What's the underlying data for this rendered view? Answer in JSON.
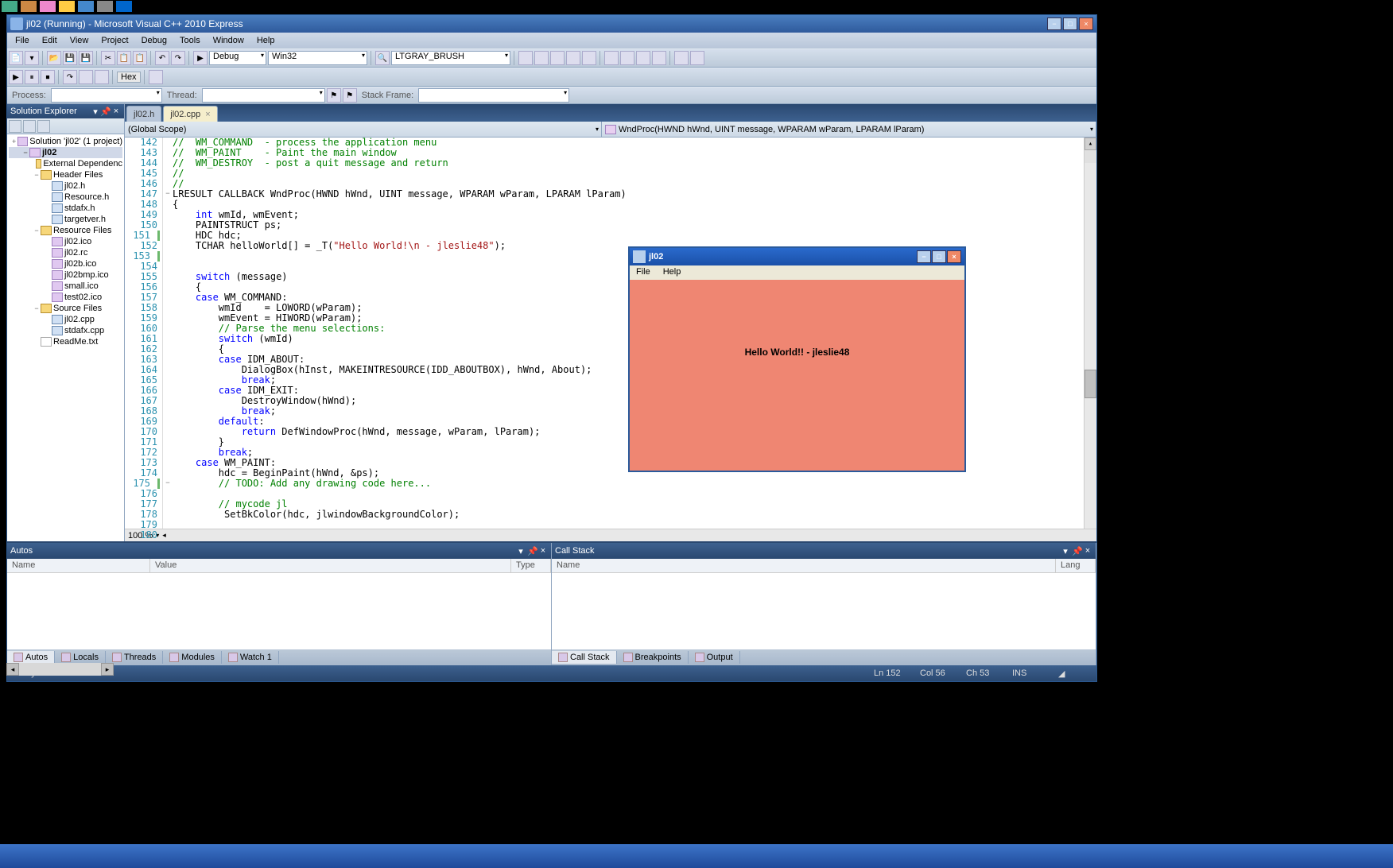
{
  "title": "jl02 (Running) - Microsoft Visual C++ 2010 Express",
  "menus": [
    "File",
    "Edit",
    "View",
    "Project",
    "Debug",
    "Tools",
    "Window",
    "Help"
  ],
  "config": "Debug",
  "platform": "Win32",
  "find": "LTGRAY_BRUSH",
  "hex": "Hex",
  "threadLabel": "Thread:",
  "stackLabel": "Stack Frame:",
  "solutionExplorer": {
    "title": "Solution Explorer"
  },
  "tree": [
    {
      "l": 0,
      "t": "+",
      "i": "sln",
      "n": "Solution 'jl02' (1 project)"
    },
    {
      "l": 1,
      "t": "−",
      "i": "prj",
      "n": "jl02",
      "bold": true,
      "sel": true
    },
    {
      "l": 2,
      "t": "",
      "i": "fld",
      "n": "External Dependenc"
    },
    {
      "l": 2,
      "t": "−",
      "i": "fld",
      "n": "Header Files"
    },
    {
      "l": 3,
      "t": "",
      "i": "cpp",
      "n": "jl02.h"
    },
    {
      "l": 3,
      "t": "",
      "i": "cpp",
      "n": "Resource.h"
    },
    {
      "l": 3,
      "t": "",
      "i": "cpp",
      "n": "stdafx.h"
    },
    {
      "l": 3,
      "t": "",
      "i": "cpp",
      "n": "targetver.h"
    },
    {
      "l": 2,
      "t": "−",
      "i": "fld",
      "n": "Resource Files"
    },
    {
      "l": 3,
      "t": "",
      "i": "ico2",
      "n": "jl02.ico"
    },
    {
      "l": 3,
      "t": "",
      "i": "ico2",
      "n": "jl02.rc"
    },
    {
      "l": 3,
      "t": "",
      "i": "ico2",
      "n": "jl02b.ico"
    },
    {
      "l": 3,
      "t": "",
      "i": "ico2",
      "n": "jl02bmp.ico"
    },
    {
      "l": 3,
      "t": "",
      "i": "ico2",
      "n": "small.ico"
    },
    {
      "l": 3,
      "t": "",
      "i": "ico2",
      "n": "test02.ico"
    },
    {
      "l": 2,
      "t": "−",
      "i": "fld",
      "n": "Source Files"
    },
    {
      "l": 3,
      "t": "",
      "i": "cpp",
      "n": "jl02.cpp"
    },
    {
      "l": 3,
      "t": "",
      "i": "cpp",
      "n": "stdafx.cpp"
    },
    {
      "l": 2,
      "t": "",
      "i": "txt",
      "n": "ReadMe.txt"
    }
  ],
  "tabs": [
    {
      "n": "jl02.h",
      "active": false
    },
    {
      "n": "jl02.cpp",
      "active": true
    }
  ],
  "navScope": "(Global Scope)",
  "navFunc": "WndProc(HWND hWnd, UINT message, WPARAM wParam, LPARAM lParam)",
  "zoom": "100 %",
  "code": [
    {
      "n": 142,
      "h": "<span class=cm>//  WM_COMMAND  - process the application menu</span>"
    },
    {
      "n": 143,
      "h": "<span class=cm>//  WM_PAINT    - Paint the main window</span>"
    },
    {
      "n": 144,
      "h": "<span class=cm>//  WM_DESTROY  - post a quit message and return</span>"
    },
    {
      "n": 145,
      "h": "<span class=cm>//</span>"
    },
    {
      "n": 146,
      "h": "<span class=cm>//</span>"
    },
    {
      "n": 147,
      "o": "−",
      "h": "LRESULT CALLBACK WndProc(HWND hWnd, UINT message, WPARAM wParam, LPARAM lParam)"
    },
    {
      "n": 148,
      "h": "{"
    },
    {
      "n": 149,
      "h": "    <span class=kw>int</span> wmId, wmEvent;"
    },
    {
      "n": 150,
      "h": "    PAINTSTRUCT ps;"
    },
    {
      "n": 151,
      "m": 1,
      "h": "    HDC hdc;"
    },
    {
      "n": 152,
      "h": "    TCHAR helloWorld[] = _T(<span class=str>\"Hello World!\\n - jleslie48\"</span>);"
    },
    {
      "n": 153,
      "m": 1,
      "h": ""
    },
    {
      "n": 154,
      "h": ""
    },
    {
      "n": 155,
      "h": "    <span class=kw>switch</span> (message)"
    },
    {
      "n": 156,
      "h": "    {"
    },
    {
      "n": 157,
      "h": "    <span class=kw>case</span> WM_COMMAND:"
    },
    {
      "n": 158,
      "h": "        wmId    = LOWORD(wParam);"
    },
    {
      "n": 159,
      "h": "        wmEvent = HIWORD(wParam);"
    },
    {
      "n": 160,
      "h": "        <span class=cm>// Parse the menu selections:</span>"
    },
    {
      "n": 161,
      "h": "        <span class=kw>switch</span> (wmId)"
    },
    {
      "n": 162,
      "h": "        {"
    },
    {
      "n": 163,
      "h": "        <span class=kw>case</span> IDM_ABOUT:"
    },
    {
      "n": 164,
      "h": "            DialogBox(hInst, MAKEINTRESOURCE(IDD_ABOUTBOX), hWnd, About);"
    },
    {
      "n": 165,
      "h": "            <span class=kw>break</span>;"
    },
    {
      "n": 166,
      "h": "        <span class=kw>case</span> IDM_EXIT:"
    },
    {
      "n": 167,
      "h": "            DestroyWindow(hWnd);"
    },
    {
      "n": 168,
      "h": "            <span class=kw>break</span>;"
    },
    {
      "n": 169,
      "h": "        <span class=kw>default</span>:"
    },
    {
      "n": 170,
      "h": "            <span class=kw>return</span> DefWindowProc(hWnd, message, wParam, lParam);"
    },
    {
      "n": 171,
      "h": "        }"
    },
    {
      "n": 172,
      "h": "        <span class=kw>break</span>;"
    },
    {
      "n": 173,
      "h": "    <span class=kw>case</span> WM_PAINT:"
    },
    {
      "n": 174,
      "h": "        hdc = BeginPaint(hWnd, &ps);"
    },
    {
      "n": 175,
      "o": "−",
      "m": 1,
      "h": "        <span class=cm>// TODO: Add any drawing code here...</span>"
    },
    {
      "n": 176,
      "h": ""
    },
    {
      "n": 177,
      "h": "        <span class=cm>// mycode jl</span>"
    },
    {
      "n": 178,
      "h": "         SetBkColor(hdc, jlwindowBackgroundColor);"
    },
    {
      "n": 179,
      "h": ""
    },
    {
      "n": 180,
      "h": ""
    }
  ],
  "autos": {
    "title": "Autos",
    "cols": [
      "Name",
      "Value",
      "Type"
    ]
  },
  "callStack": {
    "title": "Call Stack",
    "cols": [
      "Name",
      "Lang"
    ]
  },
  "autosTabs": [
    "Autos",
    "Locals",
    "Threads",
    "Modules",
    "Watch 1"
  ],
  "csTabs": [
    "Call Stack",
    "Breakpoints",
    "Output"
  ],
  "status": {
    "ready": "Ready",
    "ln": "Ln 152",
    "col": "Col 56",
    "ch": "Ch 53",
    "ins": "INS"
  },
  "app": {
    "title": "jl02",
    "menus": [
      "File",
      "Help"
    ],
    "text": "Hello World!! - jleslie48"
  }
}
